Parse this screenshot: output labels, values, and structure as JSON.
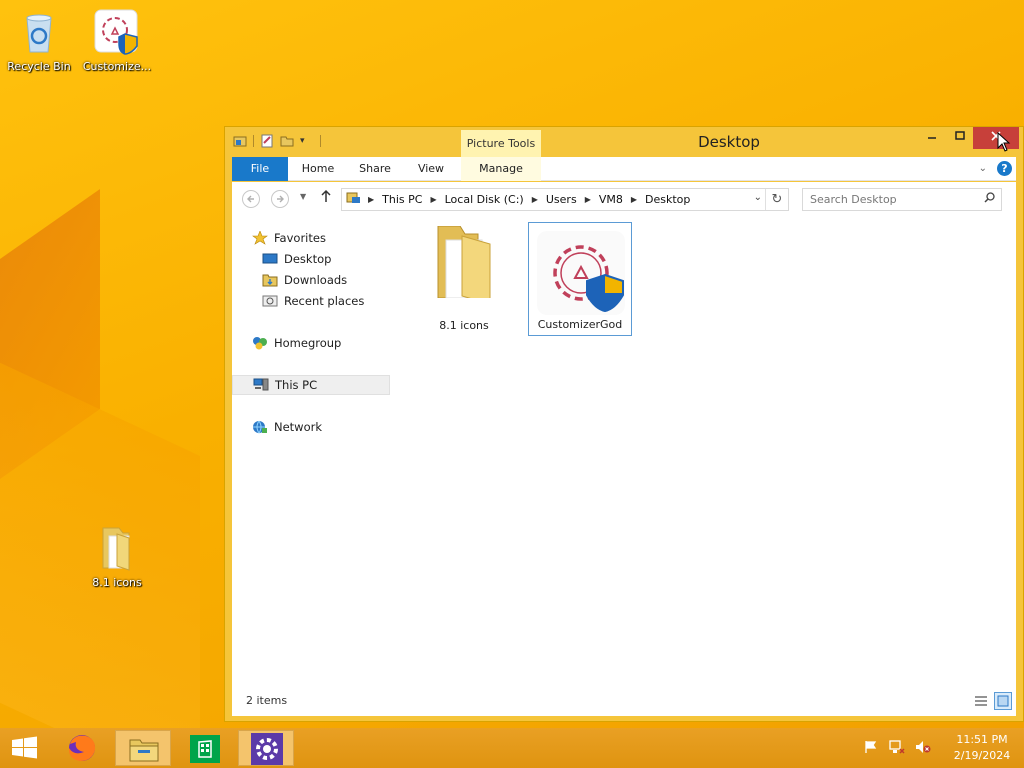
{
  "desktop": {
    "icons": [
      {
        "label": "Recycle Bin",
        "icon": "recycle-bin-icon"
      },
      {
        "label": "Customize...",
        "icon": "customizergod-app-icon"
      },
      {
        "label": "8.1 icons",
        "icon": "folder-icon"
      }
    ]
  },
  "window": {
    "title": "Desktop",
    "context_tab": "Picture Tools",
    "ribbon_tabs": [
      "File",
      "Home",
      "Share",
      "View",
      "Manage"
    ],
    "breadcrumbs": [
      "This PC",
      "Local Disk (C:)",
      "Users",
      "VM8",
      "Desktop"
    ],
    "search_placeholder": "Search Desktop",
    "nav_pane": {
      "favorites": "Favorites",
      "favorites_items": [
        "Desktop",
        "Downloads",
        "Recent places"
      ],
      "homegroup": "Homegroup",
      "this_pc": "This PC",
      "network": "Network"
    },
    "files": [
      {
        "name": "8.1 icons",
        "type": "folder"
      },
      {
        "name": "CustomizerGod",
        "type": "app",
        "selected": true
      }
    ],
    "status": "2 items"
  },
  "taskbar": {
    "clock_time": "11:51 PM",
    "clock_date": "2/19/2024"
  },
  "colors": {
    "accent": "#1979ca",
    "desktop": "#f9b000",
    "close_button": "#c7403a"
  }
}
